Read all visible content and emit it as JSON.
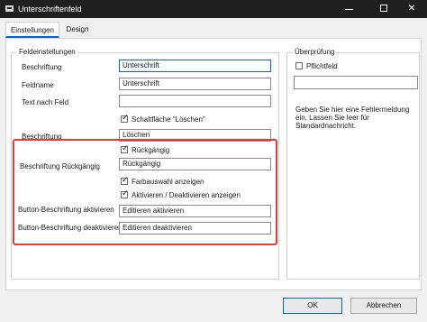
{
  "window": {
    "title": "Unterschriftenfeld"
  },
  "tabs": [
    {
      "label": "Einstellungen"
    },
    {
      "label": "Design"
    }
  ],
  "field_settings": {
    "group_title": "Feldeinstellungen",
    "beschriftung_label": "Beschriftung",
    "beschriftung_value": "Unterschrift",
    "feldname_label": "Feldname",
    "feldname_value": "Unterschrift",
    "text_nach_feld_label": "Text nach Feld",
    "text_nach_feld_value": "",
    "delete_button_checkbox_label": "Schaltfläche \"Löschen\"",
    "delete_caption_label": "Beschriftung",
    "delete_caption_value": "Löschen"
  },
  "undo_section": {
    "undo_checkbox_label": "Rückgängig",
    "undo_caption_label": "Beschriftung Rückgängig",
    "undo_caption_value": "Rückgängig",
    "color_picker_checkbox_label": "Farbauswahl anzeigen",
    "enable_disable_checkbox_label": "Aktivieren / Deaktivieren anzeigen",
    "enable_caption_label": "Button-Beschriftung aktivieren",
    "enable_caption_value": "Editieren aktivieren",
    "disable_caption_label": "Button-Beschriftung deaktivieren",
    "disable_caption_value": "Editieren deaktivieren"
  },
  "validation": {
    "group_title": "Überprüfung",
    "required_checkbox_label": "Pflichtfeld",
    "error_message_value": "",
    "help_text": "Geben Sie hier eine Fehlermeldung ein. Lassen Sie leer für Standardnachricht."
  },
  "footer": {
    "ok_label": "OK",
    "cancel_label": "Abbrechen"
  }
}
